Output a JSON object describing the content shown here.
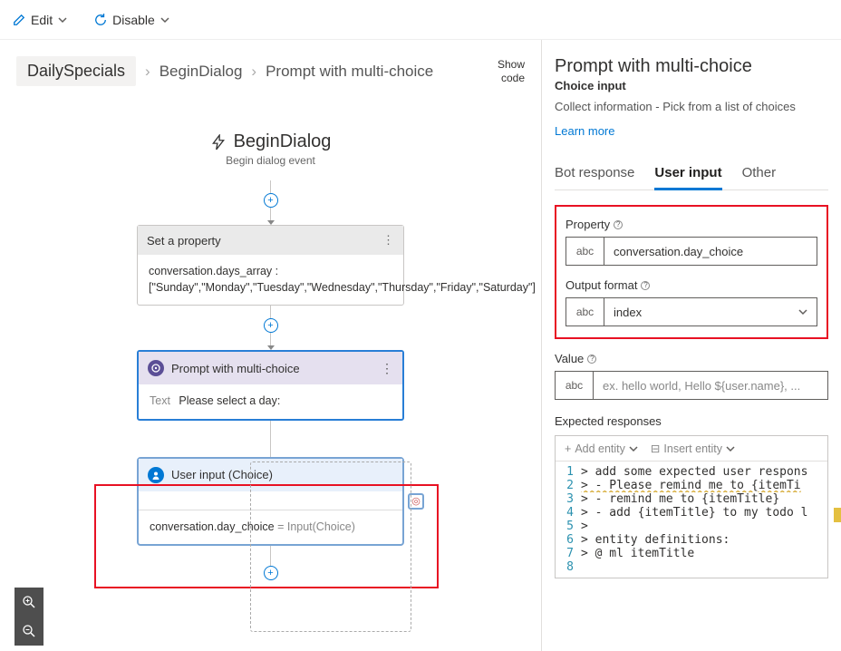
{
  "toolbar": {
    "edit_label": "Edit",
    "disable_label": "Disable"
  },
  "breadcrumb": {
    "root": "DailySpecials",
    "mid": "BeginDialog",
    "leaf": "Prompt with multi-choice",
    "show_code": "Show\ncode"
  },
  "trigger": {
    "title": "BeginDialog",
    "subtitle": "Begin dialog event"
  },
  "nodes": {
    "set_property": {
      "title": "Set a property",
      "body": "conversation.days_array :\n[\"Sunday\",\"Monday\",\"Tuesday\",\"Wednesday\",\"Thursday\",\"Friday\",\"Saturday\"]"
    },
    "prompt": {
      "title": "Prompt with multi-choice",
      "prefix": "Text",
      "text": "Please select a day:"
    },
    "input": {
      "title": "User input (Choice)",
      "prop": "conversation.day_choice",
      "eq": " = ",
      "func": "Input(Choice)"
    }
  },
  "panel": {
    "title": "Prompt with multi-choice",
    "subtitle": "Choice input",
    "description": "Collect information - Pick from a list of choices",
    "learn_more": "Learn more",
    "tabs": {
      "bot": "Bot response",
      "user": "User input",
      "other": "Other"
    },
    "property_label": "Property",
    "property_value": "conversation.day_choice",
    "output_label": "Output format",
    "output_value": "index",
    "value_label": "Value",
    "value_placeholder": "ex. hello world, Hello ${user.name}, ...",
    "expected_label": "Expected responses",
    "editor_toolbar": {
      "add_entity": "Add entity",
      "insert_entity": "Insert entity"
    },
    "abc": "abc"
  },
  "code": [
    "> add some expected user respons",
    "> - Please remind me to {itemTi",
    "> - remind me to {itemTitle}",
    "> - add {itemTitle} to my todo l",
    ">",
    "> entity definitions:",
    "> @ ml itemTitle",
    ""
  ]
}
